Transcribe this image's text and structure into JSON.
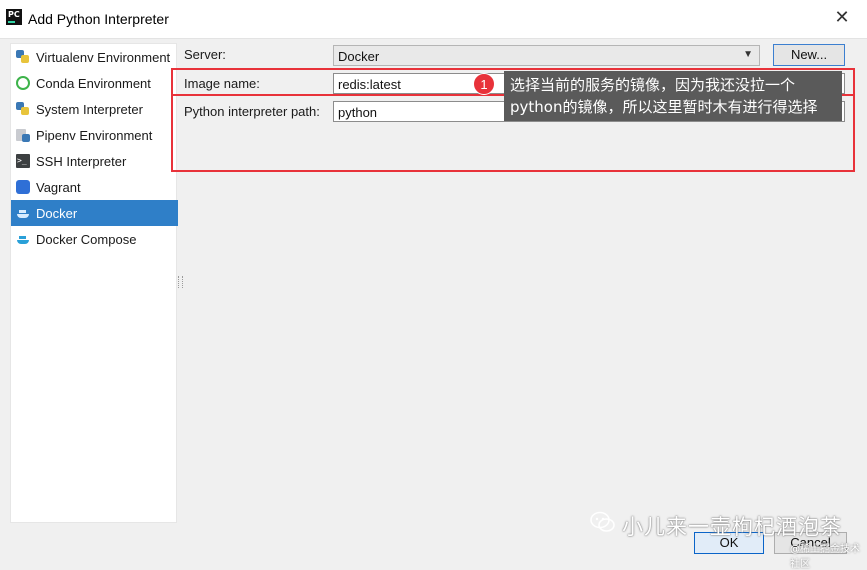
{
  "window": {
    "app_icon": "PC",
    "title": "Add Python Interpreter",
    "close_glyph": "✕"
  },
  "sidebar": {
    "items": [
      {
        "label": "Virtualenv Environment",
        "icon": "virtualenv-icon",
        "selected": false
      },
      {
        "label": "Conda Environment",
        "icon": "conda-icon",
        "selected": false
      },
      {
        "label": "System Interpreter",
        "icon": "python-icon",
        "selected": false
      },
      {
        "label": "Pipenv Environment",
        "icon": "pipenv-icon",
        "selected": false
      },
      {
        "label": "SSH Interpreter",
        "icon": "terminal-icon",
        "selected": false
      },
      {
        "label": "Vagrant",
        "icon": "vagrant-icon",
        "selected": false
      },
      {
        "label": "Docker",
        "icon": "docker-icon",
        "selected": true
      },
      {
        "label": "Docker Compose",
        "icon": "docker-compose-icon",
        "selected": false
      }
    ]
  },
  "form": {
    "server_label": "Server:",
    "server_value": "Docker",
    "new_button": "New...",
    "image_label": "Image name:",
    "image_value": "redis:latest",
    "path_label": "Python interpreter path:",
    "path_value": "python"
  },
  "annotation": {
    "badge": "1",
    "callout_line1": "选择当前的服务的镜像，因为我还没拉一个",
    "callout_line2": "python的镜像，所以这里暂时木有进行得选择"
  },
  "footer": {
    "ok_label": "OK",
    "cancel_label": "Cancel"
  },
  "watermark": {
    "text": "小儿来一壶枸杞酒泡茶",
    "sub": "@稀土掘金技术社区"
  },
  "colors": {
    "selection": "#2f7fc8",
    "highlight": "#e8323a",
    "callout_bg": "#5a5a5a"
  }
}
